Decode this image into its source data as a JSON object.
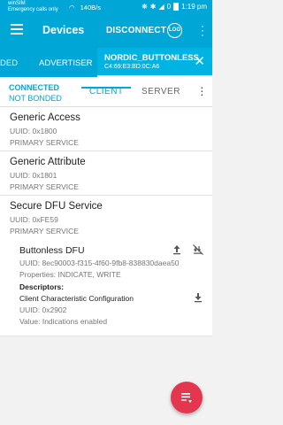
{
  "status_bar": {
    "carrier": "winSIM",
    "emergency": "Emergency calls only",
    "speed": "140B/s",
    "battery": "0",
    "time": "1:19 pm"
  },
  "app_bar": {
    "title": "Devices",
    "disconnect_label": "DISCONNECT",
    "log_label": "LOG"
  },
  "device_tabs": {
    "partial_tab": "DED",
    "advertiser_tab": "ADVERTISER",
    "active_tab": {
      "name": "NORDIC_BUTTONLESS",
      "mac": "C4:69:E3:BD:0C:A6"
    }
  },
  "connection": {
    "state": "CONNECTED",
    "bond": "NOT BONDED"
  },
  "sub_tabs": {
    "client": "CLIENT",
    "server": "SERVER"
  },
  "services": [
    {
      "name": "Generic Access",
      "uuid": "UUID: 0x1800",
      "type": "PRIMARY SERVICE"
    },
    {
      "name": "Generic Attribute",
      "uuid": "UUID: 0x1801",
      "type": "PRIMARY SERVICE"
    },
    {
      "name": "Secure DFU Service",
      "uuid": "UUID: 0xFE59",
      "type": "PRIMARY SERVICE"
    }
  ],
  "characteristic": {
    "name": "Buttonless DFU",
    "uuid": "UUID: 8ec90003-f315-4f60-9fb8-838830daea50",
    "properties": "Properties: INDICATE, WRITE",
    "descriptors_title": "Descriptors:",
    "descriptor_name": "Client Characteristic Configuration",
    "descriptor_uuid": "UUID: 0x2902",
    "descriptor_value": "Value: Indications enabled"
  },
  "colors": {
    "primary": "#00a6d6",
    "accent": "#e53650"
  }
}
